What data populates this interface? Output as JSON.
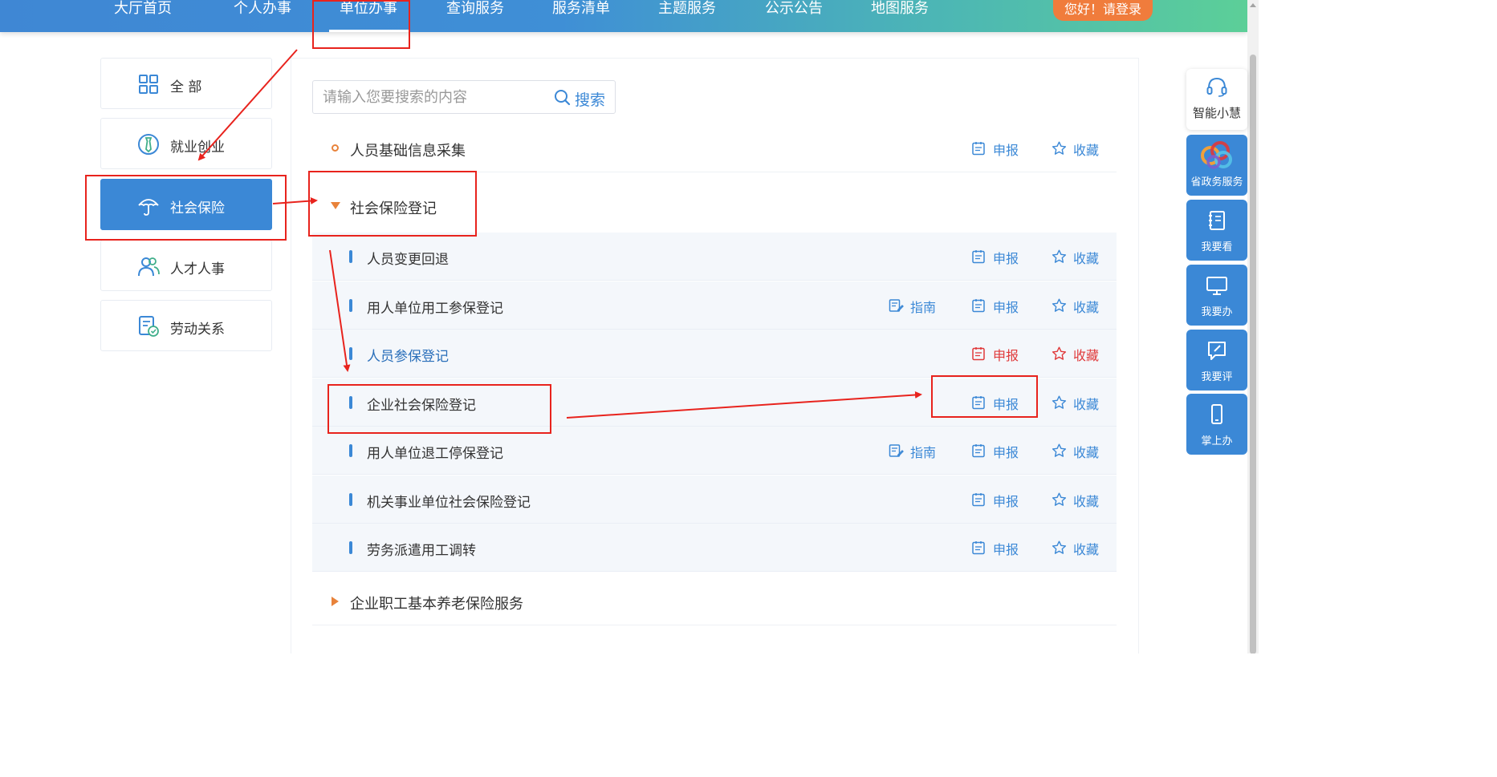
{
  "nav": {
    "items": [
      "大厅首页",
      "个人办事",
      "单位办事",
      "查询服务",
      "服务清单",
      "主题服务",
      "公示公告",
      "地图服务"
    ],
    "active_index": 2,
    "login_label": "您好！请登录"
  },
  "sidebar": {
    "items": [
      {
        "label": "全 部",
        "icon": "grid-icon"
      },
      {
        "label": "就业创业",
        "icon": "tie-icon"
      },
      {
        "label": "社会保险",
        "icon": "umbrella-icon",
        "active": true
      },
      {
        "label": "人才人事",
        "icon": "people-icon"
      },
      {
        "label": "劳动关系",
        "icon": "document-badge-icon"
      }
    ]
  },
  "search": {
    "placeholder": "请输入您要搜索的内容",
    "button_label": "搜索"
  },
  "actions": {
    "guide": "指南",
    "report": "申报",
    "favorite": "收藏"
  },
  "services": {
    "group1": {
      "title": "人员基础信息采集"
    },
    "group2": {
      "title": "社会保险登记"
    },
    "children": [
      {
        "title": "人员变更回退",
        "has_guide": false
      },
      {
        "title": "用人单位用工参保登记",
        "has_guide": true
      },
      {
        "title": "人员参保登记",
        "has_guide": false,
        "highlighted": true
      },
      {
        "title": "企业社会保险登记",
        "has_guide": false
      },
      {
        "title": "用人单位退工停保登记",
        "has_guide": true
      },
      {
        "title": "机关事业单位社会保险登记",
        "has_guide": false
      },
      {
        "title": "劳务派遣用工调转",
        "has_guide": false
      }
    ],
    "group3": {
      "title": "企业职工基本养老保险服务"
    }
  },
  "right_sidebar": {
    "items": [
      {
        "label": "智能小慧",
        "icon": "headset-icon"
      },
      {
        "label": "省政务服务",
        "icon": "brand-logo-icon"
      },
      {
        "label": "我要看",
        "icon": "notebook-icon"
      },
      {
        "label": "我要办",
        "icon": "monitor-icon"
      },
      {
        "label": "我要评",
        "icon": "edit-icon"
      },
      {
        "label": "掌上办",
        "icon": "phone-icon"
      }
    ]
  },
  "colors": {
    "accent": "#3b88d6",
    "annotation": "#e8231d",
    "orange": "#e8823a",
    "highlight_red": "#e0393a"
  }
}
